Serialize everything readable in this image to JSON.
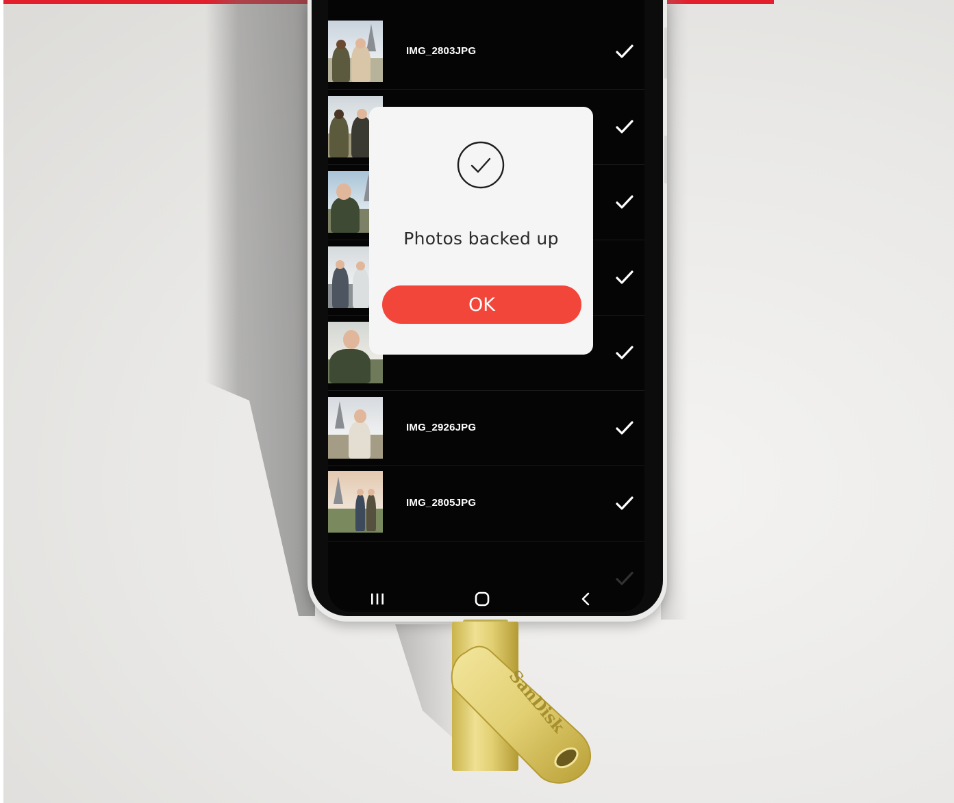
{
  "file_list": {
    "rows": [
      {
        "label": "IMG_2803JPG",
        "status": "checked"
      },
      {
        "label": "",
        "status": "checked"
      },
      {
        "label": "",
        "status": "checked"
      },
      {
        "label": "",
        "status": "checked"
      },
      {
        "label": "",
        "status": "checked"
      },
      {
        "label": "IMG_2926JPG",
        "status": "checked"
      },
      {
        "label": "IMG_2805JPG",
        "status": "checked"
      },
      {
        "label": "",
        "status": "checked"
      }
    ]
  },
  "dialog": {
    "icon": "check-circle-icon",
    "message": "Photos backed up",
    "ok_label": "OK"
  },
  "nav_bar": {
    "recents_icon": "recents-icon",
    "home_icon": "home-icon",
    "back_icon": "back-icon"
  },
  "usb_drive": {
    "brand": "SanDisk"
  },
  "colors": {
    "accent_red": "#e31e2d",
    "ok_button": "#f2463b",
    "screen_bg": "#050505",
    "usb_gold": "#e2d073"
  }
}
